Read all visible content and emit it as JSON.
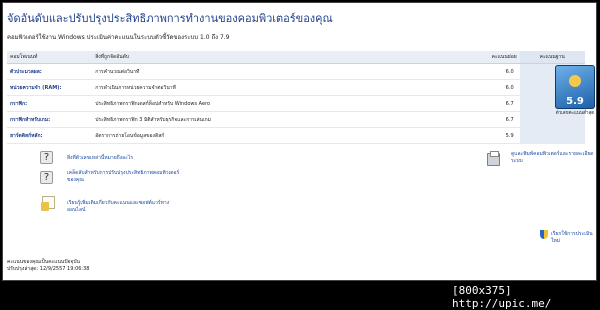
{
  "header": {
    "title": "จัดอันดับและปรับปรุงประสิทธิภาพการทำงานของคอมพิวเตอร์ของคุณ",
    "subtitle": "คอมพิวเตอร์ใช้งาน Windows ประเมินค่าคะแนนในระบบตัวชี้วัดของระบบ 1.0 ถึง 7.9"
  },
  "table": {
    "headers": {
      "component": "คอมโพเนนท์",
      "rated_by": "สิ่งที่ถูกจัดอันดับ",
      "subscore": "คะแนนย่อย",
      "base_score": "คะแนนฐาน"
    },
    "rows": [
      {
        "component": "ตัวประมวลผล:",
        "description": "การคำนวณต่อวินาที",
        "score": "6.0"
      },
      {
        "component": "หน่วยความจำ (RAM):",
        "description": "การดำเนินการหน่วยความจำต่อวินาที",
        "score": "6.0"
      },
      {
        "component": "กราฟิก:",
        "description": "ประสิทธิภาพกราฟิกเดสก์ท็อปสำหรับ Windows Aero",
        "score": "6.7"
      },
      {
        "component": "กราฟิกสำหรับเกม:",
        "description": "ประสิทธิภาพกราฟิก 3 มิติสำหรับธุรกิจและการเล่นเกม",
        "score": "6.7"
      },
      {
        "component": "ฮาร์ดดิสก์หลัก:",
        "description": "อัตราการถ่ายโอนข้อมูลของดิสก์",
        "score": "5.9"
      }
    ],
    "base_score_value": "5.9",
    "base_score_caption": "ตัวเลขคะแนนต่ำสุด"
  },
  "links": {
    "what_numbers_mean": "สิ่งที่ตัวเลขเหล่านี้หมายถึงอะไร",
    "tips": "เคล็ดลับสำหรับการปรับปรุงประสิทธิภาพคอมพิวเตอร์ของคุณ",
    "learn_more": "เรียนรู้เพิ่มเติมเกี่ยวกับคะแนนและซอฟต์แวร์ทางออนไลน์",
    "print_details": "ดูและพิมพ์คอมพิวเตอร์และรายละเอียดระบบ"
  },
  "footer": {
    "status_line": "คะแนนของคุณเป็นคะแนนปัจจุบัน",
    "last_updated_label": "ปรับปรุงล่าสุด:",
    "last_updated_value": "12/9/2557 19:06:38",
    "rerun": "เรียกใช้การประเมินใหม่"
  },
  "watermark": "[800x375] http://upic.me/",
  "colors": {
    "title": "#1e3f8a",
    "link": "#1a4aa2",
    "header_bg": "#e9eef5",
    "badge": "#1c5fa8"
  },
  "icons": [
    "question-icon",
    "document-icon",
    "printer-icon",
    "shield-icon",
    "performance-badge-icon"
  ]
}
